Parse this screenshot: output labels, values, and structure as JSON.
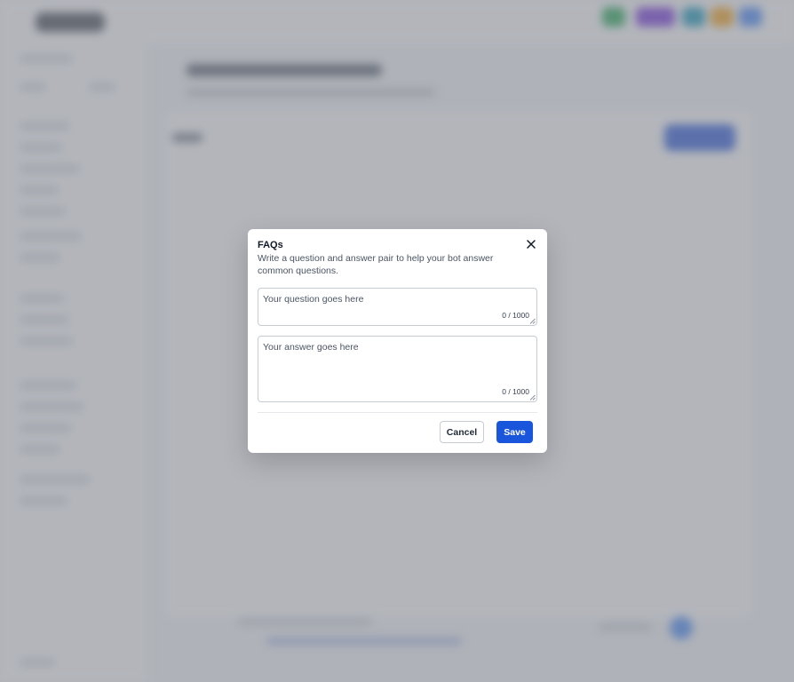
{
  "modal": {
    "title": "FAQs",
    "description": "Write a question and answer pair to help your bot answer common questions.",
    "close_icon": "close-icon",
    "question": {
      "placeholder": "Your question goes here",
      "value": "",
      "counter": "0 / 1000"
    },
    "answer": {
      "placeholder": "Your answer goes here",
      "value": "",
      "counter": "0 / 1000"
    },
    "buttons": {
      "cancel_label": "Cancel",
      "save_label": "Save"
    }
  },
  "colors": {
    "primary": "#1a56db",
    "overlay": "rgba(17,24,39,0.30)",
    "border": "#c7ccd3"
  }
}
